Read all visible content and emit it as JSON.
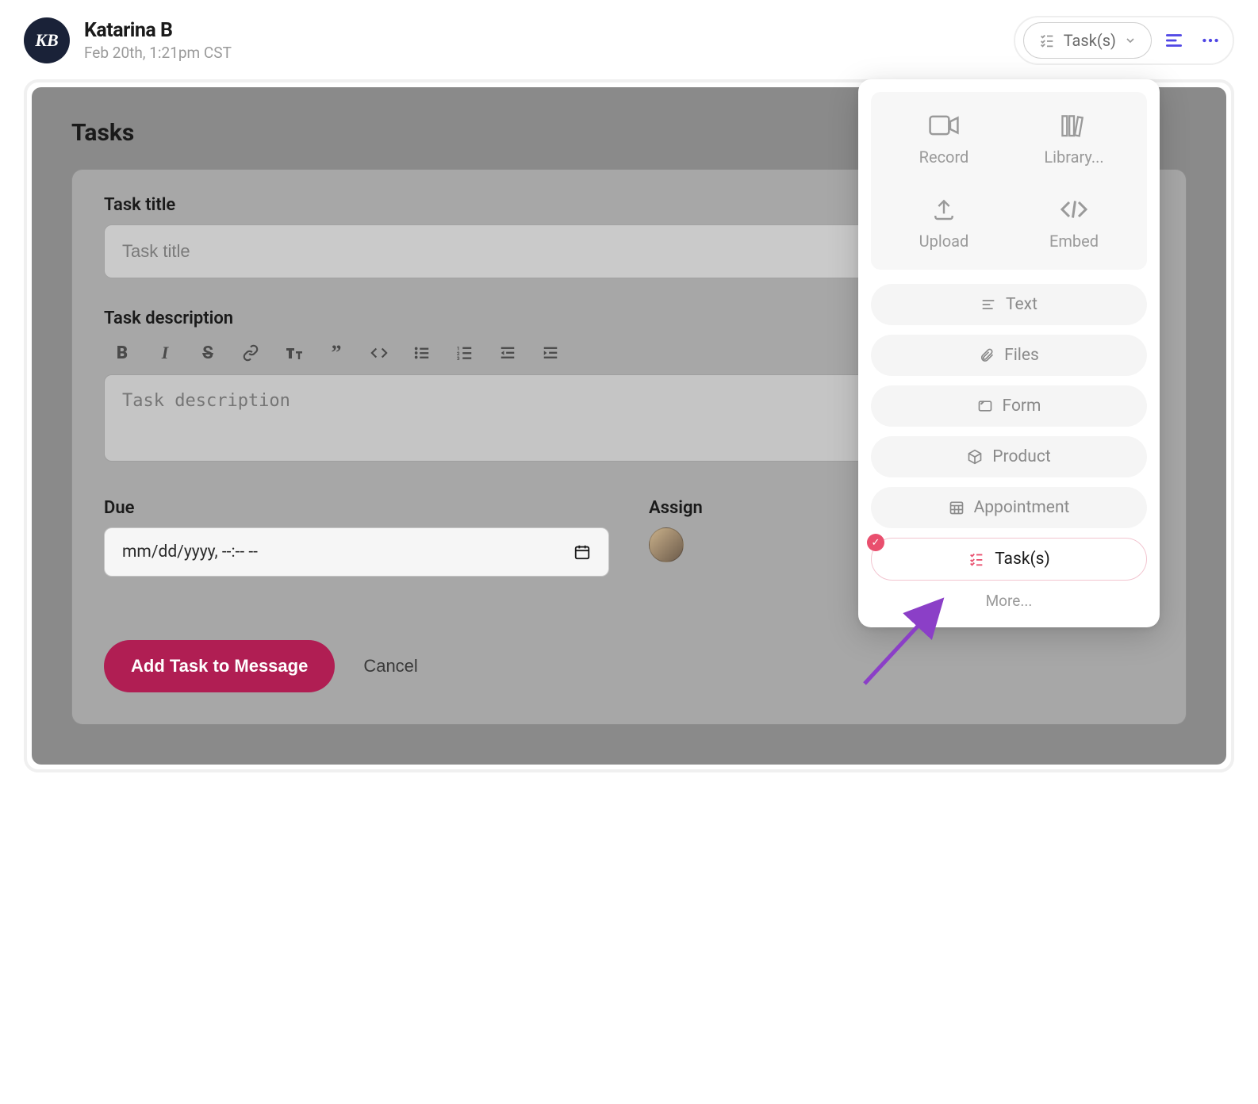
{
  "header": {
    "avatar_initials": "KB",
    "user_name": "Katarina B",
    "timestamp": "Feb 20th, 1:21pm CST",
    "type_pill": "Task(s)"
  },
  "tasks_panel": {
    "section_title": "Tasks",
    "title_label": "Task title",
    "title_placeholder": "Task title",
    "title_value": "",
    "desc_label": "Task description",
    "desc_placeholder": "Task description",
    "desc_value": "",
    "due_label": "Due",
    "due_placeholder": "mm/dd/yyyy, --:-- --",
    "assignee_label": "Assign",
    "submit_label": "Add Task to Message",
    "cancel_label": "Cancel"
  },
  "popover": {
    "grid": [
      {
        "id": "record",
        "label": "Record",
        "icon": "video"
      },
      {
        "id": "library",
        "label": "Library...",
        "icon": "library"
      },
      {
        "id": "upload",
        "label": "Upload",
        "icon": "upload"
      },
      {
        "id": "embed",
        "label": "Embed",
        "icon": "code"
      }
    ],
    "list": [
      {
        "id": "text",
        "label": "Text",
        "icon": "text",
        "selected": false
      },
      {
        "id": "files",
        "label": "Files",
        "icon": "clip",
        "selected": false
      },
      {
        "id": "form",
        "label": "Form",
        "icon": "form",
        "selected": false
      },
      {
        "id": "product",
        "label": "Product",
        "icon": "cube",
        "selected": false
      },
      {
        "id": "appointment",
        "label": "Appointment",
        "icon": "calendar",
        "selected": false
      },
      {
        "id": "tasks",
        "label": "Task(s)",
        "icon": "tasks",
        "selected": true
      }
    ],
    "more_label": "More..."
  }
}
